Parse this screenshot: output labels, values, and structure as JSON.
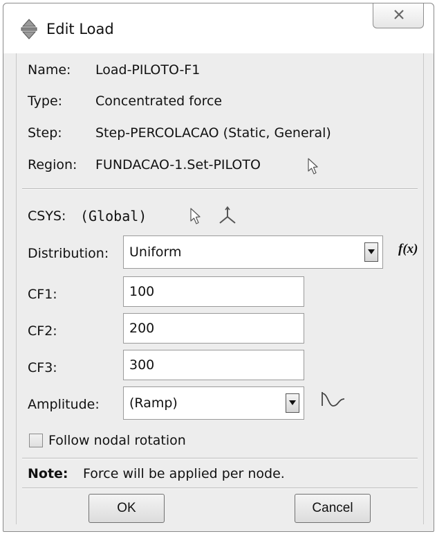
{
  "window": {
    "title": "Edit Load",
    "close_glyph": "✕"
  },
  "info": {
    "name_label": "Name:",
    "name_value": "Load-PILOTO-F1",
    "type_label": "Type:",
    "type_value": "Concentrated force",
    "step_label": "Step:",
    "step_value": "Step-PERCOLACAO (Static, General)",
    "region_label": "Region:",
    "region_value": "FUNDACAO-1.Set-PILOTO"
  },
  "csys": {
    "label": "CSYS:",
    "value": "(Global)"
  },
  "distribution": {
    "label": "Distribution:",
    "selected": "Uniform",
    "fx_label": "f(x)"
  },
  "components": [
    {
      "label": "CF1:",
      "value": "100"
    },
    {
      "label": "CF2:",
      "value": "200"
    },
    {
      "label": "CF3:",
      "value": "300"
    }
  ],
  "amplitude": {
    "label": "Amplitude:",
    "selected": "(Ramp)"
  },
  "follow_nodal_rotation": {
    "label": "Follow nodal rotation",
    "checked": false
  },
  "note": {
    "label": "Note:",
    "text": "Force will be applied per node."
  },
  "buttons": {
    "ok": "OK",
    "cancel": "Cancel"
  },
  "icons": [
    "edit-load-icon",
    "close-icon",
    "select-region-arrow-icon",
    "select-csys-arrow-icon",
    "csys-axes-icon",
    "dropdown-arrow-icon",
    "amplitude-curve-icon"
  ]
}
